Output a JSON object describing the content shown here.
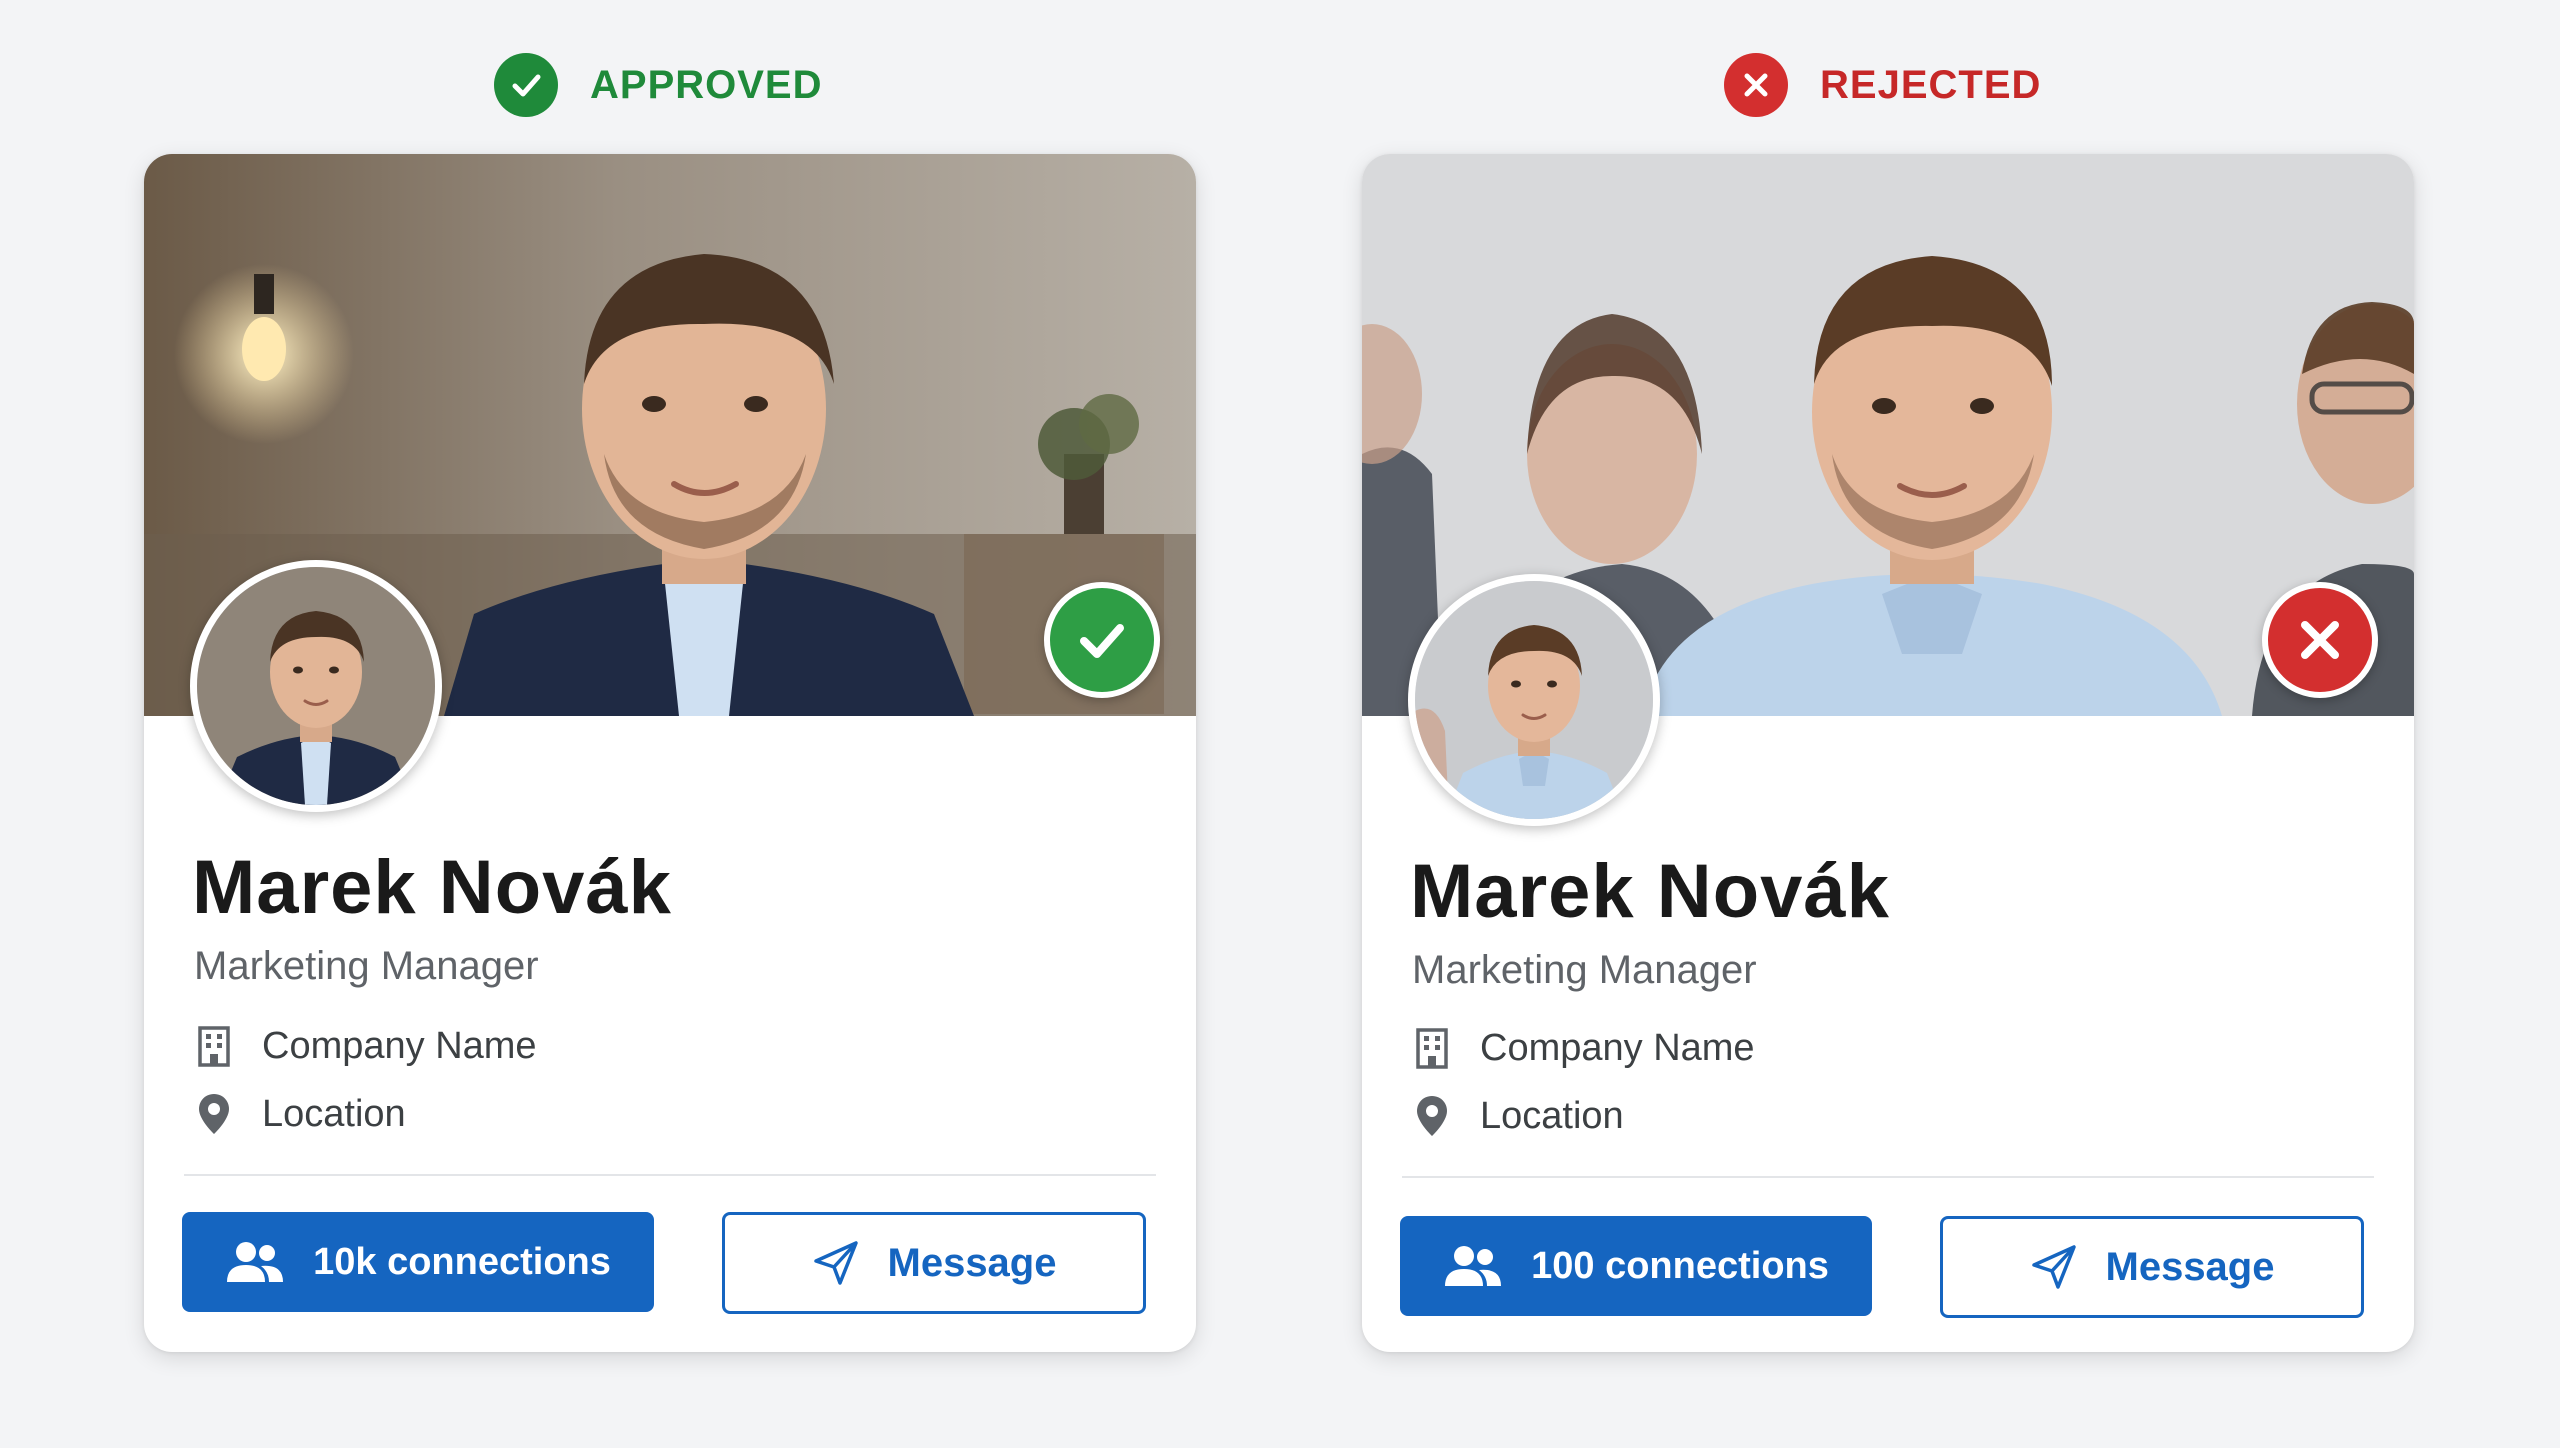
{
  "cards": [
    {
      "verdict": "APPROVED",
      "verdict_icon": "check-circle-icon",
      "status_color": "#1f8a3a",
      "name": "Marek Novák",
      "job_title": "Marketing Manager",
      "company": "Company Name",
      "location": "Location",
      "connections_label": "10k connections",
      "message_label": "Message"
    },
    {
      "verdict": "REJECTED",
      "verdict_icon": "x-circle-icon",
      "status_color": "#d32f2f",
      "name": "Marek Novák",
      "job_title": "Marketing Manager",
      "company": "Company Name",
      "location": "Location",
      "connections_label": "100 connections",
      "message_label": "Message"
    }
  ],
  "colors": {
    "primary": "#1565c0",
    "approved": "#1f8a3a",
    "rejected": "#d32f2f"
  }
}
